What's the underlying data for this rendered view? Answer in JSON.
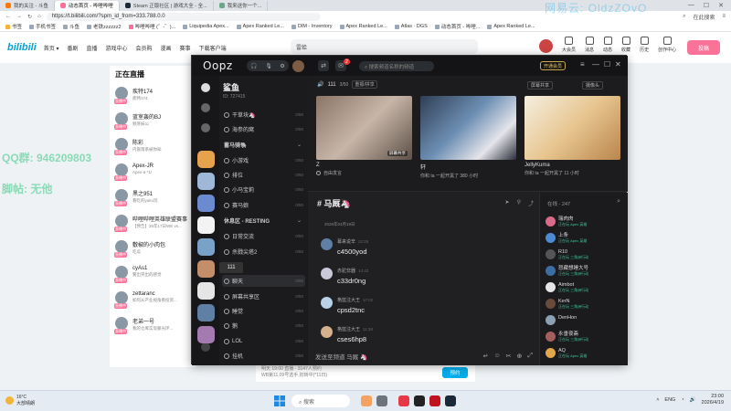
{
  "browser": {
    "tabs": [
      "我的关注 - 斗鱼",
      "动态首页 - 哔哩哔哩",
      "Steam 正版社区 | 游戏大全 - 全...",
      "我来送你一个..."
    ],
    "url": "https://t.bilibili.com/?spm_id_from=333.788.0.0",
    "right_label": "在此搜索",
    "bookmarks": [
      "书签",
      "手机书签",
      "斗鱼",
      "老铁zzzzzz2",
      "哔哩哔哩 (゜-゜)...",
      "Liquipedia Apex...",
      "Apex Ranked Le...",
      "DIM - Inventory",
      "Apex Ranked Le...",
      "Atlas · DGS",
      "动态首页 - 哔哩...",
      "Apex Ranked Le..."
    ]
  },
  "bili": {
    "logo": "bilibili",
    "nav": [
      "首页 ▾",
      "番剧",
      "直播",
      "游戏中心",
      "会员购",
      "漫画",
      "赛事",
      "下载客户端"
    ],
    "search_placeholder": "雷蛤",
    "user_items": [
      "大会员",
      "消息",
      "动态",
      "收藏",
      "历史",
      "创作中心"
    ],
    "upload": "投稿",
    "live_title": "正在直播",
    "streamers": [
      {
        "name": "疾特174",
        "desc": "疾特174",
        "badge": "直播中"
      },
      {
        "name": "蓝室轰的BJ",
        "desc": "顾蒸妹公",
        "badge": "直播中"
      },
      {
        "name": "陈彩",
        "desc": "内嵌雨系被你知",
        "badge": "直播中"
      },
      {
        "name": "Apex-JR",
        "desc": "Apex-a *1/",
        "badge": "直播中"
      },
      {
        "name": "黑之951",
        "desc": "看吃的yuko玩",
        "badge": "直播中"
      },
      {
        "name": "哔哩哔哩英雄联盟赛事",
        "desc": "【预告】26年17日WE vs...",
        "badge": "直播中"
      },
      {
        "name": "敷椒的小肉包",
        "desc": "吃瓜",
        "badge": "直播中"
      },
      {
        "name": "cyAs1",
        "desc": "繁出突出的感觉",
        "badge": "直播中"
      },
      {
        "name": "zettaranc",
        "desc": "如何从产业视角看投资...",
        "badge": "直播中"
      },
      {
        "name": "老弟一号",
        "desc": "我的仓库实现蒙光环...",
        "badge": "直播中"
      }
    ],
    "bottom_text": "明天 19:00 直播 · 3147人预约",
    "bottom_sub": "WB第11,09号选手,初转中(*11日)",
    "reserve_btn": "预约"
  },
  "overlay": {
    "watermark": "网易云: OldzZOvO",
    "qq": "QQ群: 946209803",
    "post": "脚帖: 无他"
  },
  "oopz": {
    "logo": "Oopz",
    "search_placeholder": "搜索频道名称的频道",
    "member_btn": "开通会员",
    "server_name": "鲨鱼",
    "server_id": "ID: 727415",
    "notif_count": "2",
    "channels": [
      {
        "label": "干草块🦄",
        "count": "0/50",
        "type": "voice"
      },
      {
        "label": "海参的窝",
        "count": "0/50",
        "type": "voice"
      },
      {
        "label": "蓄马骑🐘",
        "count": "",
        "type": "category"
      },
      {
        "label": "小游戏",
        "count": "0/50",
        "type": "voice"
      },
      {
        "label": "排位",
        "count": "0/50",
        "type": "voice"
      },
      {
        "label": "小马宝莉",
        "count": "0/50",
        "type": "voice"
      },
      {
        "label": "赛马娘",
        "count": "0/50",
        "type": "voice"
      },
      {
        "label": "休息区 - RESTING",
        "count": "",
        "type": "category"
      },
      {
        "label": "日常交流",
        "count": "0/50",
        "type": "voice"
      },
      {
        "label": "杀戮尖塔2",
        "count": "0/50",
        "type": "voice"
      },
      {
        "label": "聊天",
        "count": "0/50",
        "type": "voice"
      },
      {
        "label": "屏幕共享区",
        "count": "0/50",
        "type": "voice"
      },
      {
        "label": "睡觉",
        "count": "0/50",
        "type": "voice"
      },
      {
        "label": "鹅",
        "count": "0/50",
        "type": "voice"
      },
      {
        "label": "LOL",
        "count": "0/50",
        "type": "voice"
      },
      {
        "label": "挂机",
        "count": "0/50",
        "type": "voice"
      }
    ],
    "tooltip": "111",
    "voice": {
      "title": "111",
      "count": "3/50",
      "tag": "重振/拼享",
      "btn_share": "屏幕共享",
      "btn_camera": "摄像头",
      "screen_tag": "屏幕共享",
      "cards": [
        {
          "name": "Z",
          "sub": "自由发言"
        },
        {
          "name": "轩",
          "sub": "你和 ta 一起开黑了 380 小时"
        },
        {
          "name": "JellyKuma",
          "sub": "你和 ta 一起开黑了 11 小时"
        }
      ]
    },
    "chat": {
      "title": "马厩🦄",
      "date": "2026年04月19日",
      "messages": [
        {
          "user": "幕来说辛",
          "time": "22:26",
          "text": "c4500yod"
        },
        {
          "user": "赤驼非器",
          "time": "14:42",
          "text": "c33dr0ng"
        },
        {
          "user": "格蓝注大王",
          "time": "17:02",
          "text": "cpsd2tnc"
        },
        {
          "user": "格蓝注大王",
          "time": "11:38",
          "text": "cses6hp8"
        }
      ],
      "input_placeholder": "发送至频道 马厩 🦄"
    },
    "online": {
      "head": "在线 - 247",
      "members": [
        {
          "name": "瑞肉肉",
          "status": "正在玩 Apex 英雄"
        },
        {
          "name": "上条",
          "status": "正在玩 Apex 英雄"
        },
        {
          "name": "R10",
          "status": "正在玩 三角洲行动"
        },
        {
          "name": "怒藏想睡大号",
          "status": "正在玩 三角洲行动"
        },
        {
          "name": "Aimbot",
          "status": "正在玩 三角洲行动"
        },
        {
          "name": "KerN",
          "status": "正在玩 三角洲行动"
        },
        {
          "name": "DenHon",
          "status": ""
        },
        {
          "name": "永垂夜斋",
          "status": "正在玩 三角洲行动"
        },
        {
          "name": "AQ",
          "status": "正在玩 Apex 英雄"
        }
      ]
    }
  },
  "taskbar": {
    "weather_temp": "16°C",
    "weather_desc": "大部晴朗",
    "search_label": "搜索",
    "lang": "ENG",
    "time": "23:00",
    "date": "2026/4/19"
  },
  "colors": {
    "bili_pink": "#fb7299",
    "bili_blue": "#00a1d6",
    "oopz_bg": "#1f1f22",
    "online_green": "#33cc99"
  }
}
